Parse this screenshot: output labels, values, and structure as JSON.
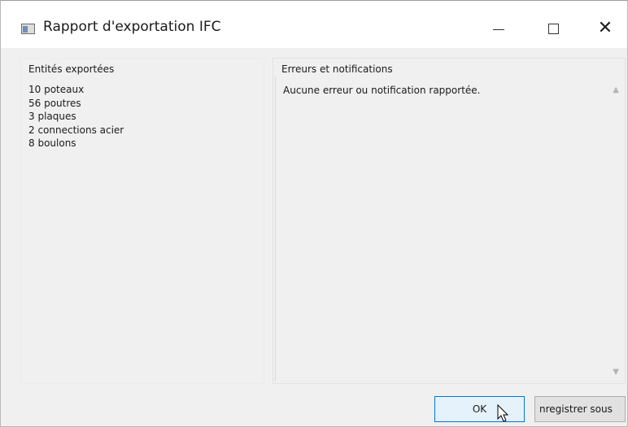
{
  "window": {
    "title": "Rapport d'exportation IFC",
    "icon": "application-window-icon",
    "controls": {
      "minimize": "minimize-icon",
      "maximize": "maximize-icon",
      "close_glyph": "✕"
    }
  },
  "left_panel": {
    "header": "Entités exportées",
    "items": [
      "10 poteaux",
      "56 poutres",
      "3 plaques",
      "2 connections acier",
      "8 boulons"
    ]
  },
  "right_panel": {
    "header": "Erreurs et notifications",
    "message": "Aucune erreur ou notification rapportée."
  },
  "footer": {
    "ok_label": "OK",
    "save_label": "nregistrer sous"
  },
  "colors": {
    "accent": "#0078d7",
    "window_bg": "#f0f0f0"
  }
}
